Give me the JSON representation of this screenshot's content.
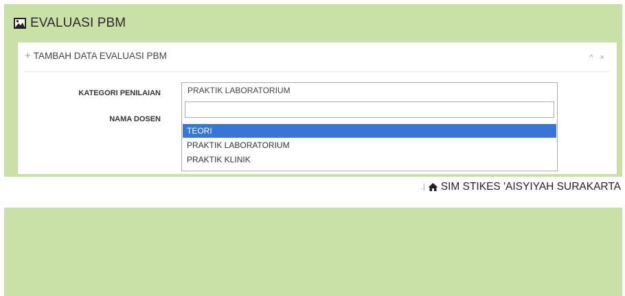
{
  "page": {
    "title": "EVALUASI PBM",
    "title_icon": "image-icon"
  },
  "box": {
    "header": "TAMBAH DATA EVALUASI PBM",
    "header_icon": "plus-icon",
    "tools": {
      "collapse": "^",
      "remove": "×"
    }
  },
  "form": {
    "kategori_label": "KATEGORI PENILAIAN",
    "kategori_value": "PRAKTIK LABORATORIUM",
    "dosen_label": "NAMA DOSEN",
    "search_value": "",
    "options": [
      "TEORI",
      "PRAKTIK LABORATORIUM",
      "PRAKTIK KLINIK"
    ],
    "highlighted_option": "TEORI"
  },
  "footer": {
    "separator": ".|",
    "brand": "SIM STIKES 'AISYIYAH SURAKARTA",
    "brand_icon": "home-icon"
  },
  "colors": {
    "panel_bg": "#c9e0a7",
    "highlight": "#3875d7"
  }
}
